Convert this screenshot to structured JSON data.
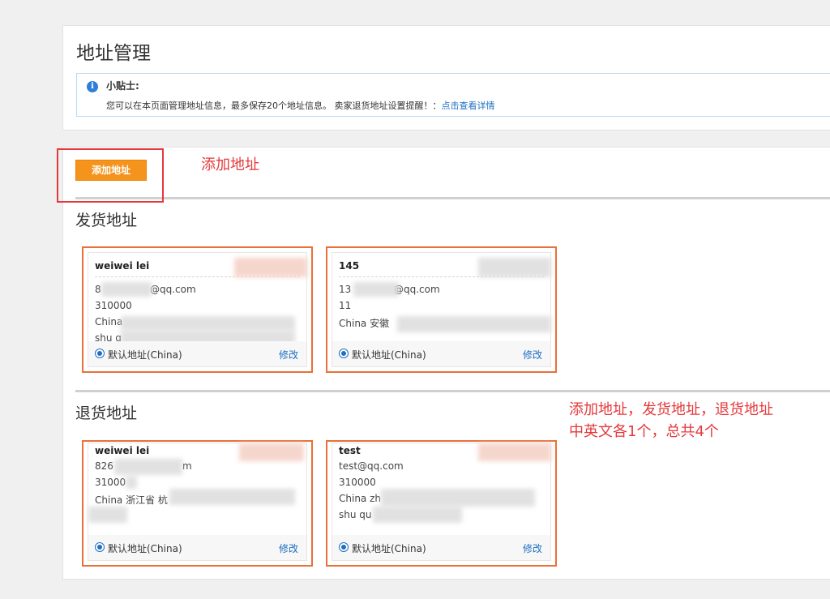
{
  "page_title": "地址管理",
  "tip": {
    "title": "小贴士:",
    "text": "您可以在本页面管理地址信息，最多保存20个地址信息。 卖家退货地址设置提醒！：",
    "link": "点击查看详情",
    "icon": "info-icon"
  },
  "add_button": "添加地址",
  "annotations": {
    "add": "添加地址",
    "note_line1": "添加地址，发货地址，退货地址",
    "note_line2": "中英文各1个，总共4个",
    "color": "#e4393c"
  },
  "sections": {
    "shipping": {
      "title": "发货地址",
      "cards": [
        {
          "name": "weiwei lei",
          "lines": [
            "8",
            "@qq.com",
            "310000",
            "China",
            "shu q"
          ],
          "default": "默认地址(China)",
          "edit": "修改"
        },
        {
          "name": "145",
          "lines": [
            "13",
            "@qq.com",
            "11",
            "China 安徽"
          ],
          "default": "默认地址(China)",
          "edit": "修改"
        }
      ]
    },
    "return": {
      "title": "退货地址",
      "cards": [
        {
          "name": "weiwei lei",
          "lines": [
            "826",
            "m",
            "31000",
            "China 浙江省 杭"
          ],
          "default": "默认地址(China)",
          "edit": "修改"
        },
        {
          "name": "test",
          "lines": [
            "test@qq.com",
            "310000",
            "China zh",
            "shu qu"
          ],
          "default": "默认地址(China)",
          "edit": "修改"
        }
      ]
    }
  },
  "colors": {
    "accent_button": "#f5941c",
    "card_border": "#e8703a",
    "link": "#1e6fc2"
  }
}
